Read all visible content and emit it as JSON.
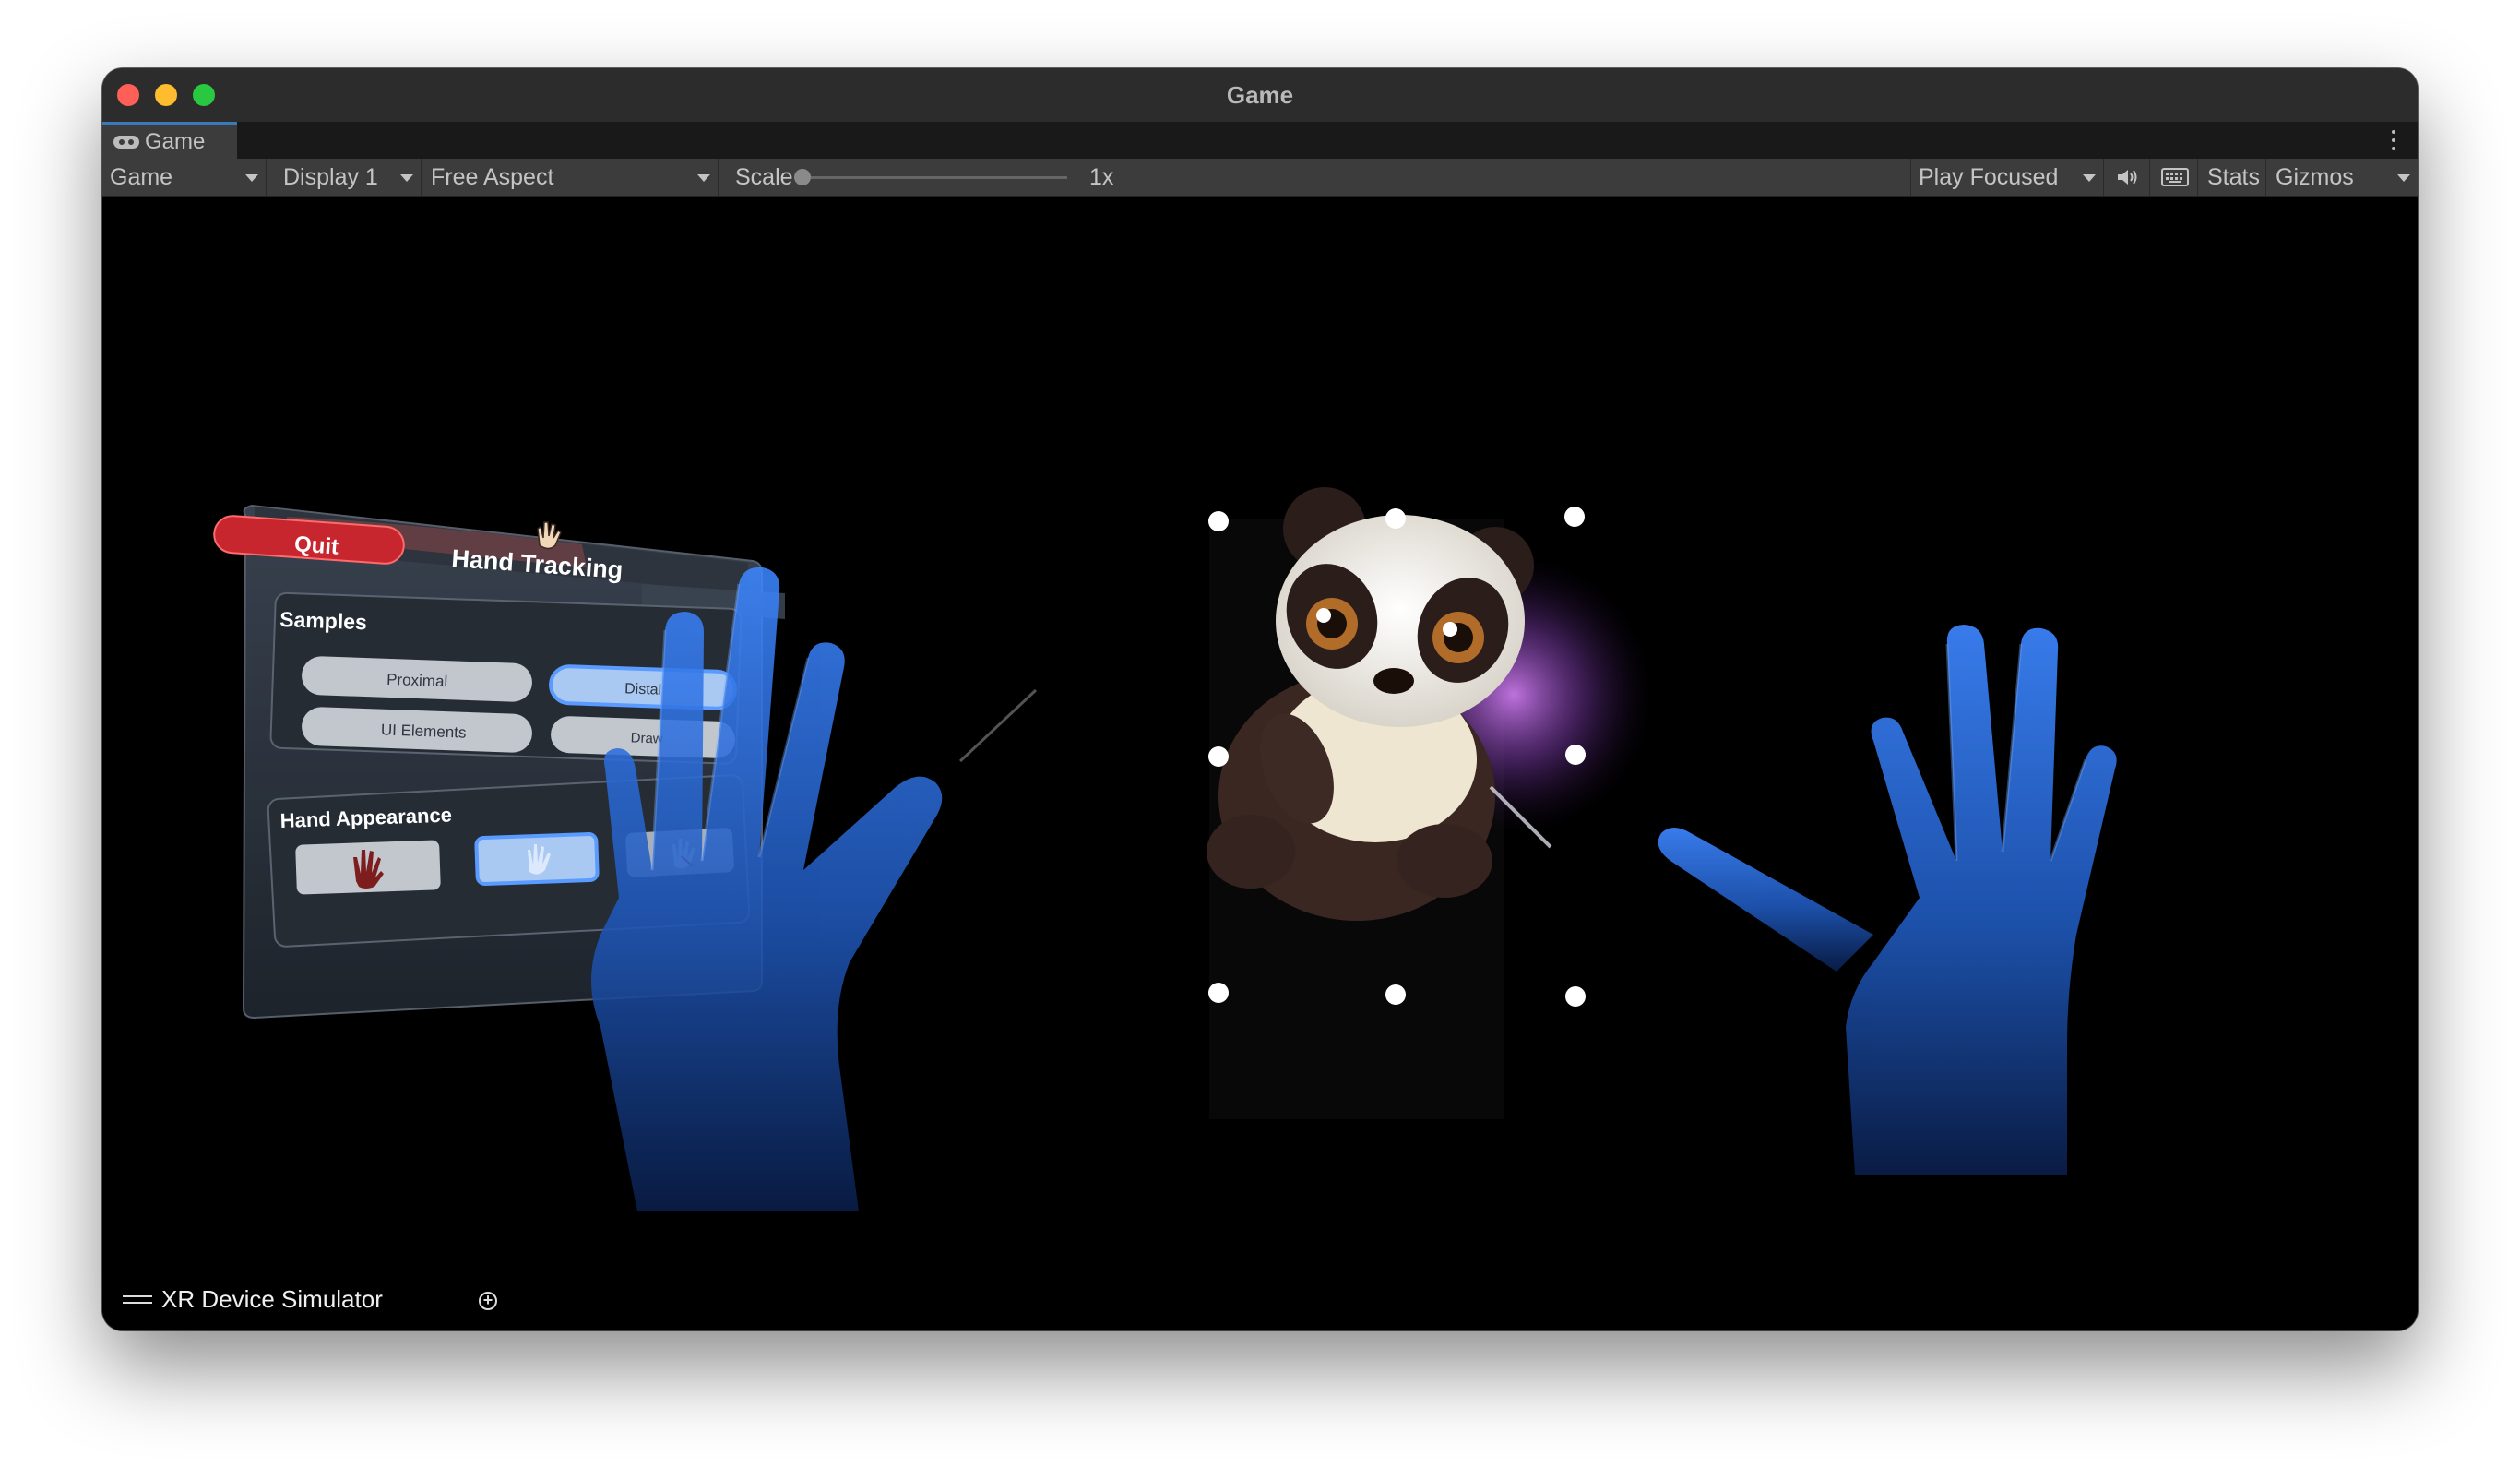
{
  "window": {
    "title": "Game"
  },
  "tab": {
    "label": "Game",
    "icon": "gamepad-icon"
  },
  "toolbar": {
    "view_mode": "Game",
    "display": "Display 1",
    "aspect": "Free Aspect",
    "scale_label": "Scale",
    "scale_value": "1x",
    "scale_level": 0,
    "play_mode": "Play Focused",
    "stats": "Stats",
    "gizmos": "Gizmos"
  },
  "menu_panel": {
    "quit": "Quit",
    "title": "Hand Tracking",
    "samples_heading": "Samples",
    "samples": [
      "Proximal",
      "Distal",
      "UI Elements",
      "Draw"
    ],
    "appearance_heading": "Hand Appearance"
  },
  "xr_simulator": {
    "label": "XR Device Simulator"
  },
  "colors": {
    "titlebar": "#2c2c2c",
    "toolbar": "#3c3c3c",
    "tab_accent": "#3a79bb",
    "quit_red": "#c8262f",
    "hand_blue": "#2f6fd8"
  }
}
